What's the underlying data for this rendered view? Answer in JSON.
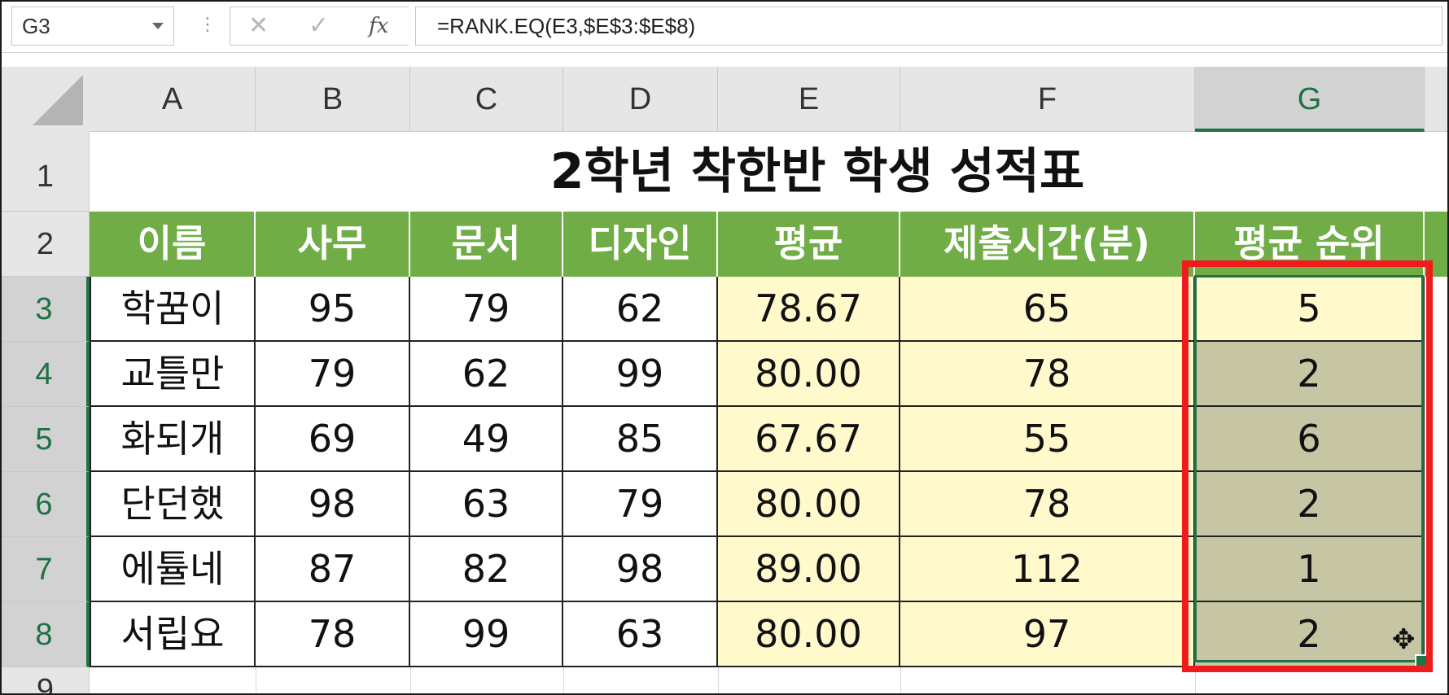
{
  "formula_bar": {
    "name_box": "G3",
    "more_icon": "⋮",
    "cancel_icon": "✕",
    "enter_icon": "✓",
    "fx_label": "fx",
    "formula": "=RANK.EQ(E3,$E$3:$E$8)"
  },
  "columns": [
    "A",
    "B",
    "C",
    "D",
    "E",
    "F",
    "G"
  ],
  "rows": [
    "1",
    "2",
    "3",
    "4",
    "5",
    "6",
    "7",
    "8",
    "9"
  ],
  "sheet": {
    "title": "2학년 착한반 학생 성적표",
    "headers": [
      "이름",
      "사무",
      "문서",
      "디자인",
      "평균",
      "제출시간(분)",
      "평균 순위"
    ],
    "data": [
      [
        "학꿈이",
        "95",
        "79",
        "62",
        "78.67",
        "65",
        "5"
      ],
      [
        "교틀만",
        "79",
        "62",
        "99",
        "80.00",
        "78",
        "2"
      ],
      [
        "화되개",
        "69",
        "49",
        "85",
        "67.67",
        "55",
        "6"
      ],
      [
        "단던했",
        "98",
        "63",
        "79",
        "80.00",
        "78",
        "2"
      ],
      [
        "에튤네",
        "87",
        "82",
        "98",
        "89.00",
        "112",
        "1"
      ],
      [
        "서립요",
        "78",
        "99",
        "63",
        "80.00",
        "97",
        "2"
      ]
    ]
  },
  "colors": {
    "header_green": "#70ad47",
    "highlight_red": "#ee1c1c",
    "selection_green": "#217346",
    "average_fill": "#fff9cc",
    "selected_fill": "#c6c6a4"
  },
  "cursor_icon": "✥"
}
